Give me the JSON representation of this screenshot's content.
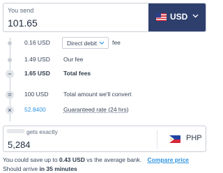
{
  "send": {
    "label": "You send",
    "amount": "101.65",
    "currency": "USD",
    "flag_icon": "us-flag-icon"
  },
  "breakdown": [
    {
      "value": "0.16 USD",
      "dropdown_value": "Direct debit",
      "suffix": "fee",
      "marker": "dot"
    },
    {
      "value": "1.49 USD",
      "description": "Our fee",
      "marker": "dot"
    },
    {
      "value": "1.65 USD",
      "description": "Total fees",
      "marker": "minus",
      "marker_glyph": "−"
    },
    {
      "value": "100 USD",
      "description": "Total amount we'll convert",
      "marker": "equals",
      "marker_glyph": "="
    },
    {
      "value": "52.8400",
      "description": "Guaranteed rate (24 hrs)",
      "marker": "times",
      "marker_glyph": "×"
    }
  ],
  "receive": {
    "label": "gets exactly",
    "amount": "5,284",
    "currency": "PHP",
    "flag_icon": "ph-flag-icon"
  },
  "savings": {
    "prefix": "You could save up to",
    "amount": "0.43 USD",
    "suffix": "vs the average bank.",
    "link": "Compare price"
  },
  "arrival": {
    "prefix": "Should arrive",
    "time": "in 35 minutes"
  },
  "colors": {
    "accent_blue": "#2c93e0",
    "currency_button_bg": "#2e3f6e",
    "border": "#c9ced6"
  }
}
